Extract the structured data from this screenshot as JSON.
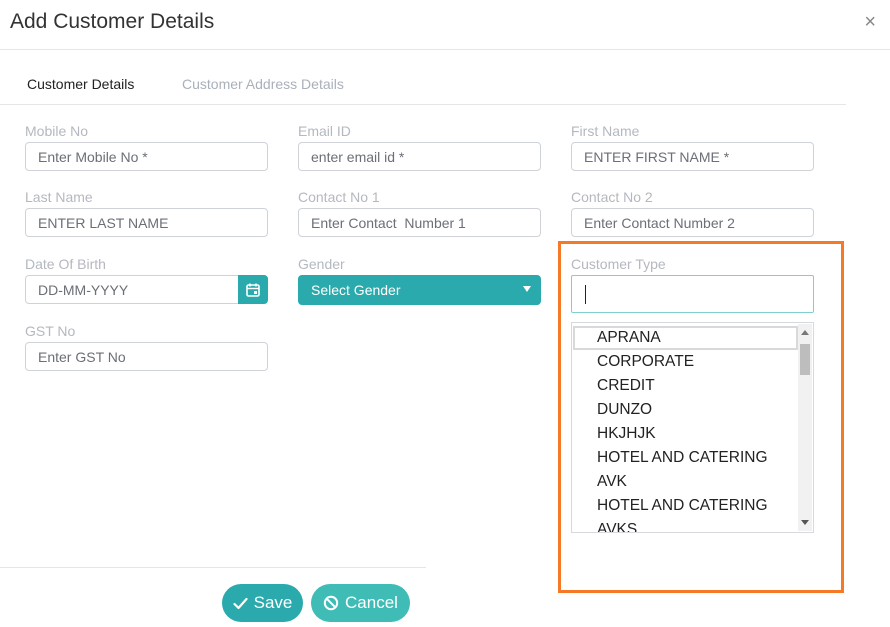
{
  "modal": {
    "title": "Add Customer Details",
    "close_symbol": "×"
  },
  "tabs": [
    {
      "label": "Customer Details",
      "active": true
    },
    {
      "label": "Customer Address Details",
      "active": false
    }
  ],
  "fields": {
    "mobile_no": {
      "label": "Mobile No",
      "placeholder": "Enter Mobile No *"
    },
    "email_id": {
      "label": "Email ID",
      "placeholder": "enter email id *"
    },
    "first_name": {
      "label": "First Name",
      "placeholder": "ENTER FIRST NAME *"
    },
    "last_name": {
      "label": "Last Name",
      "placeholder": "ENTER LAST NAME"
    },
    "contact_no_1": {
      "label": "Contact No 1",
      "placeholder": "Enter Contact  Number 1"
    },
    "contact_no_2": {
      "label": "Contact No 2",
      "placeholder": "Enter Contact Number 2"
    },
    "date_of_birth": {
      "label": "Date Of Birth",
      "placeholder": "DD-MM-YYYY",
      "icon": "calendar-icon"
    },
    "gender": {
      "label": "Gender",
      "selected": "Select Gender",
      "icon": "caret-down-icon"
    },
    "customer_type": {
      "label": "Customer Type",
      "value": ""
    },
    "gst_no": {
      "label": "GST No",
      "placeholder": "Enter GST No"
    }
  },
  "customer_type_options": [
    "APRANA",
    "CORPORATE",
    "CREDIT",
    "DUNZO",
    "HKJHJK",
    "HOTEL AND CATERING",
    "AVK",
    "HOTEL AND CATERING",
    "AVKS"
  ],
  "buttons": {
    "save": {
      "label": "Save",
      "icon": "check-icon"
    },
    "cancel": {
      "label": "Cancel",
      "icon": "ban-icon"
    }
  },
  "colors": {
    "accent": "#2aaaad",
    "highlight": "#f47a25"
  }
}
